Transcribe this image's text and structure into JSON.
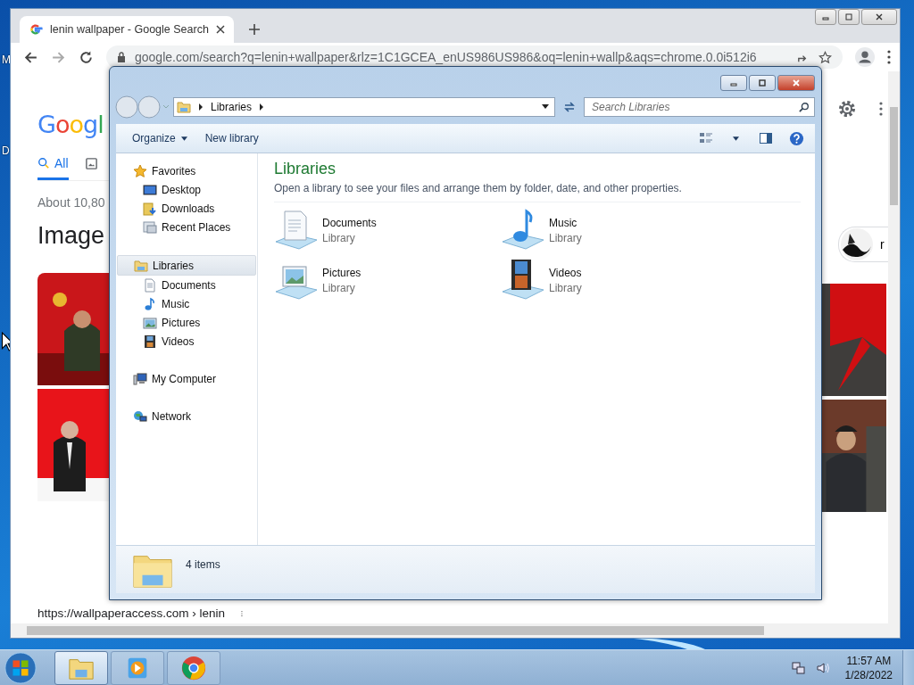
{
  "desktop": {
    "icon_labels": [
      "M",
      "D"
    ]
  },
  "browser": {
    "tab": {
      "title": "lenin wallpaper - Google Search"
    },
    "address": "google.com/search?q=lenin+wallpaper&rlz=1C1GCEA_enUS986US986&oq=lenin+wallp&aqs=chrome.0.0i512i6",
    "page": {
      "logo": "Googl",
      "search_tabs": [
        {
          "label": "All",
          "selected": true
        }
      ],
      "result_count": "About 10,80",
      "images_heading": "Image",
      "chip_label": "r",
      "result_url": "https://wallpaperaccess.com › lenin"
    }
  },
  "explorer": {
    "breadcrumb": [
      "Libraries"
    ],
    "search_placeholder": "Search Libraries",
    "toolbar": [
      "Organize",
      "New library"
    ],
    "nav": [
      {
        "label": "Favorites",
        "kind": "favorites",
        "selected": false,
        "children": [
          {
            "label": "Desktop",
            "kind": "desktop",
            "selected": false
          },
          {
            "label": "Downloads",
            "kind": "downloads",
            "selected": false
          },
          {
            "label": "Recent Places",
            "kind": "recent",
            "selected": false
          }
        ]
      },
      {
        "label": "Libraries",
        "kind": "libraries",
        "selected": true,
        "children": [
          {
            "label": "Documents",
            "kind": "documents",
            "selected": false
          },
          {
            "label": "Music",
            "kind": "music",
            "selected": false
          },
          {
            "label": "Pictures",
            "kind": "pictures",
            "selected": false
          },
          {
            "label": "Videos",
            "kind": "videos",
            "selected": false
          }
        ]
      },
      {
        "label": "My Computer",
        "kind": "computer",
        "selected": false
      },
      {
        "label": "Network",
        "kind": "network",
        "selected": false
      }
    ],
    "heading": "Libraries",
    "description": "Open a library to see your files and arrange them by folder, date, and other properties.",
    "items": [
      {
        "name": "Documents",
        "type": "Library",
        "kind": "documents"
      },
      {
        "name": "Music",
        "type": "Library",
        "kind": "music"
      },
      {
        "name": "Pictures",
        "type": "Library",
        "kind": "pictures"
      },
      {
        "name": "Videos",
        "type": "Library",
        "kind": "videos"
      }
    ],
    "status": "4 items"
  },
  "taskbar": {
    "apps": [
      {
        "kind": "explorer",
        "selected": true
      },
      {
        "kind": "media",
        "selected": false
      },
      {
        "kind": "chrome",
        "selected": false
      }
    ],
    "time": "11:57 AM",
    "date": "1/28/2022"
  }
}
